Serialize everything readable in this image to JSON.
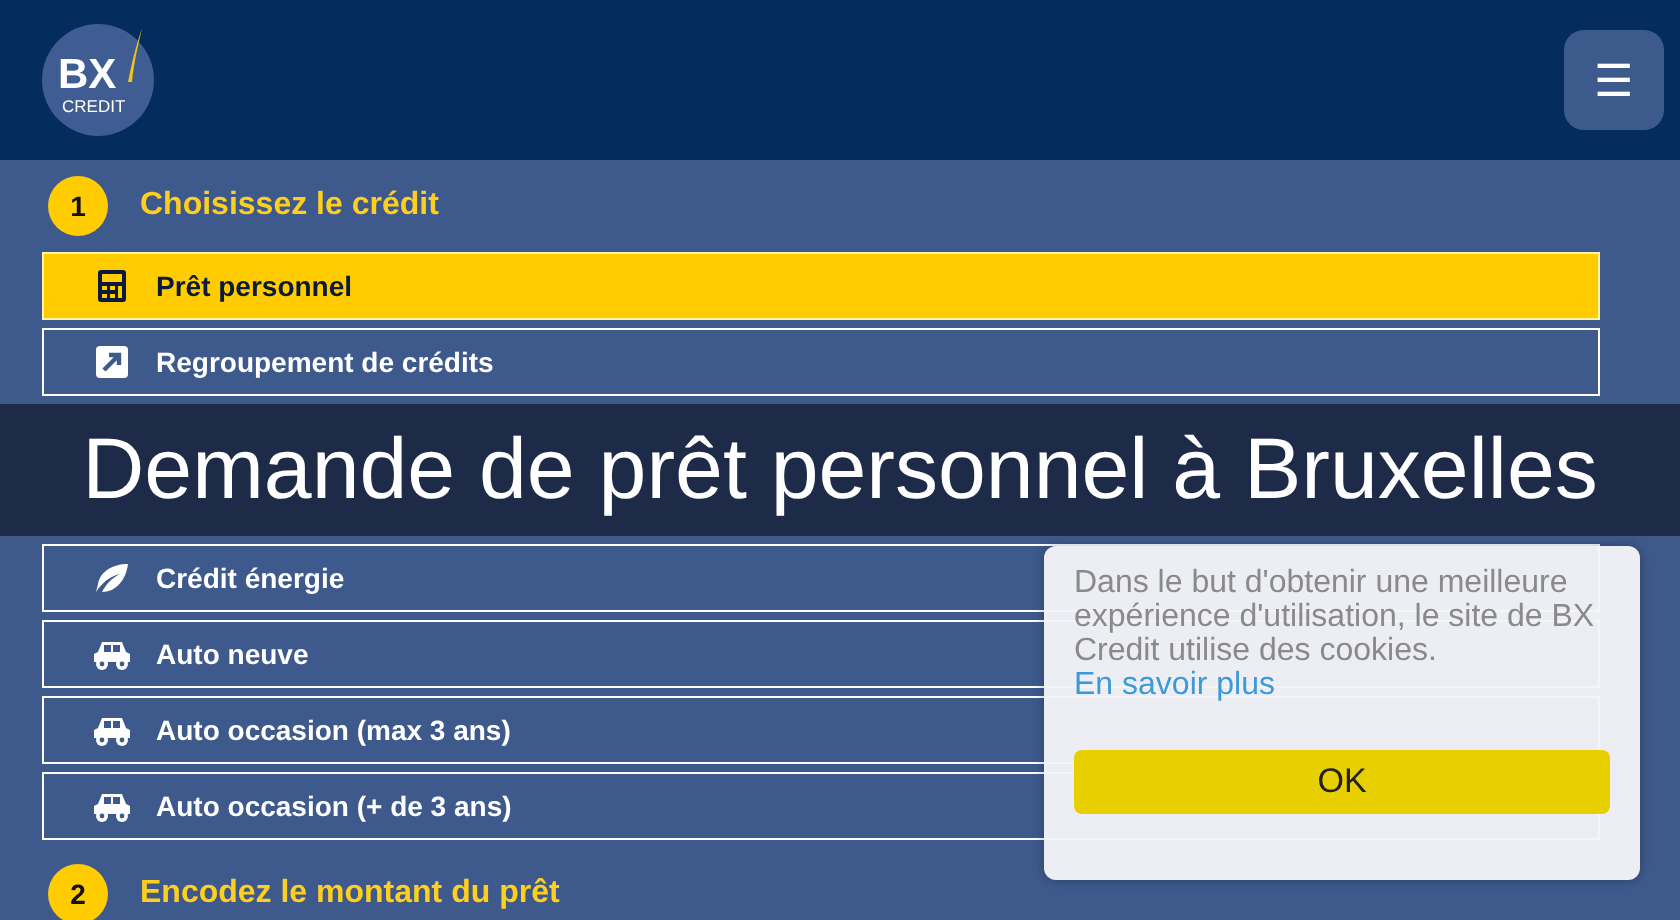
{
  "header": {
    "logo": {
      "letters": "BX",
      "subtitle": "CREDIT"
    },
    "menu_button": {
      "glyph": "☰"
    }
  },
  "steps": [
    {
      "number": "1",
      "title": "Choisissez le crédit",
      "options": [
        {
          "kind": "calculator",
          "label": "Prêt personnel",
          "selected": true
        },
        {
          "kind": "arrow",
          "label": "Regroupement de crédits",
          "selected": false
        },
        {
          "kind": "leaf",
          "label": "Crédit énergie",
          "selected": false
        },
        {
          "kind": "car",
          "label": "Auto neuve",
          "selected": false
        },
        {
          "kind": "car",
          "label": "Auto occasion (max 3 ans)",
          "selected": false
        },
        {
          "kind": "car",
          "label": "Auto occasion (+ de 3 ans)",
          "selected": false
        }
      ]
    },
    {
      "number": "2",
      "title": "Encodez le montant du prêt"
    }
  ],
  "banner": {
    "title": "Demande de prêt personnel à Bruxelles"
  },
  "cookie_notice": {
    "text": "Dans le but d'obtenir une meilleure expérience d'utilisation, le site de BX Credit utilise des cookies.",
    "link": "En savoir plus",
    "button": "OK"
  }
}
